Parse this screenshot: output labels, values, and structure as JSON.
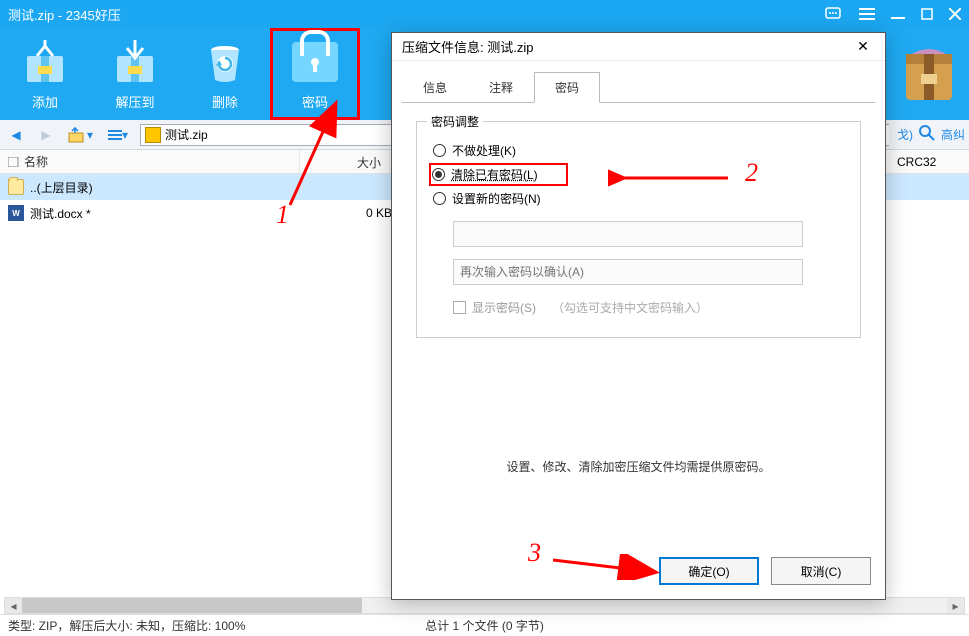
{
  "title": "测试.zip - 2345好压",
  "toolbar": {
    "add": "添加",
    "extract": "解压到",
    "delete": "删除",
    "password": "密码"
  },
  "address": "测试.zip",
  "columns": {
    "name": "名称",
    "size": "大小",
    "crc": "CRC32"
  },
  "files": {
    "up": "..(上层目录)",
    "f1_name": "测试.docx *",
    "f1_size": "0 KB"
  },
  "status_left": "类型:  ZIP，解压后大小:  未知，压缩比:  100%",
  "status_mid": "总计 1 个文件 (0 字节)",
  "rightbar": {
    "close_paren": "戈)",
    "adv": "高纠"
  },
  "dialog": {
    "title": "压缩文件信息: 测试.zip",
    "tab1": "信息",
    "tab2": "注释",
    "tab3": "密码",
    "legend": "密码调整",
    "r1": "不做处理(K)",
    "r2": "清除已有密码(L)",
    "r3": "设置新的密码(N)",
    "pw2_placeholder": "再次输入密码以确认(A)",
    "showpw": "显示密码(S)",
    "hint": "（勾选可支持中文密码输入）",
    "note": "设置、修改、清除加密压缩文件均需提供原密码。",
    "ok": "确定(O)",
    "cancel": "取消(C)"
  },
  "anno": {
    "n1": "1",
    "n2": "2",
    "n3": "3"
  }
}
